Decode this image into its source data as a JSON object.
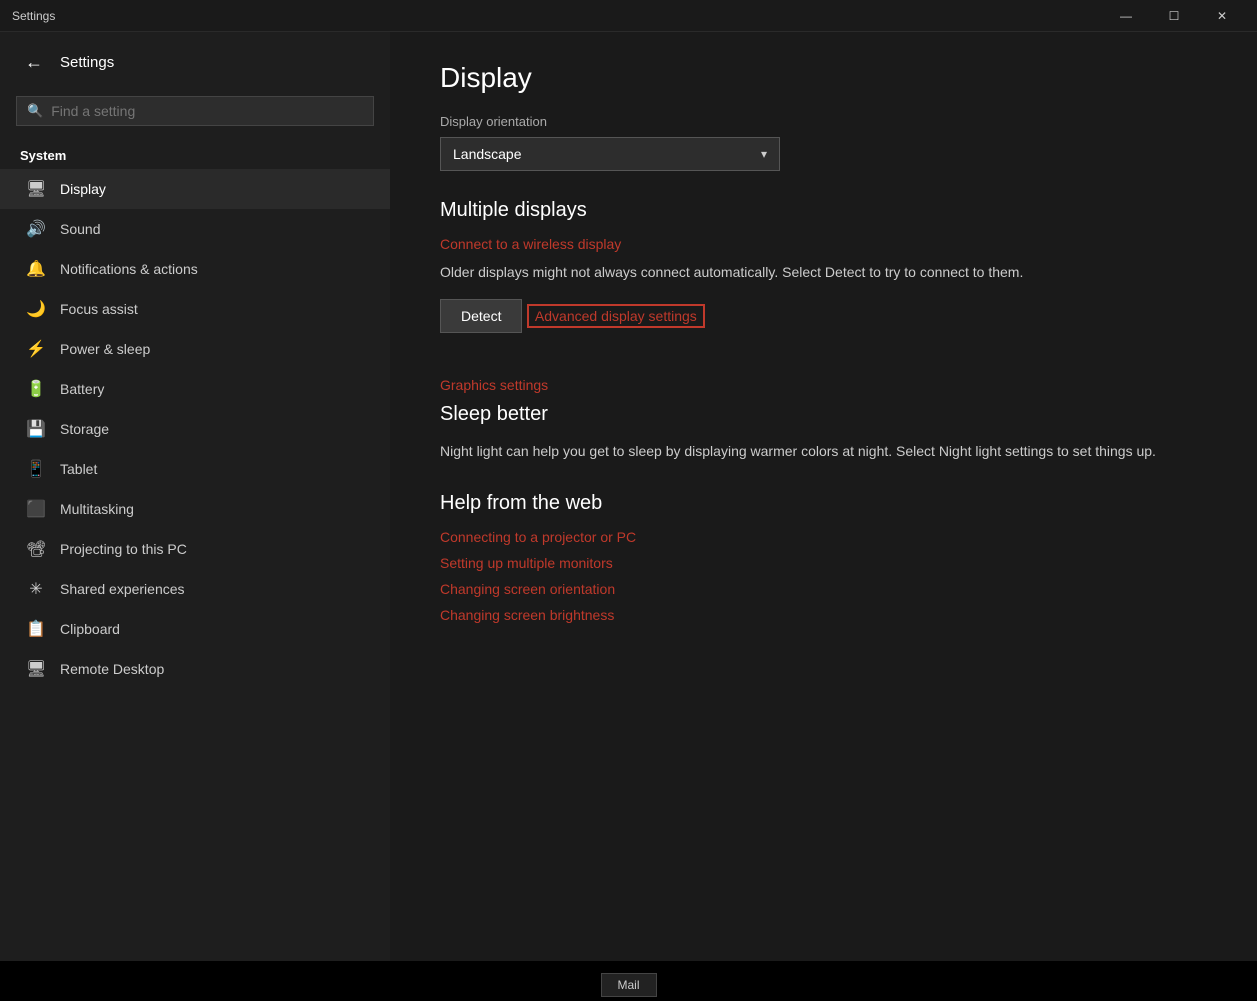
{
  "titlebar": {
    "title": "Settings",
    "minimize": "—",
    "restore": "☐",
    "close": "✕"
  },
  "sidebar": {
    "back_label": "←",
    "app_name": "Settings",
    "search_placeholder": "Find a setting",
    "system_label": "System",
    "nav_items": [
      {
        "id": "display",
        "icon": "🖥",
        "label": "Display",
        "active": true
      },
      {
        "id": "sound",
        "icon": "🔊",
        "label": "Sound",
        "active": false
      },
      {
        "id": "notifications",
        "icon": "🔔",
        "label": "Notifications & actions",
        "active": false
      },
      {
        "id": "focus",
        "icon": "🌙",
        "label": "Focus assist",
        "active": false
      },
      {
        "id": "power",
        "icon": "⚡",
        "label": "Power & sleep",
        "active": false
      },
      {
        "id": "battery",
        "icon": "🔋",
        "label": "Battery",
        "active": false
      },
      {
        "id": "storage",
        "icon": "💾",
        "label": "Storage",
        "active": false
      },
      {
        "id": "tablet",
        "icon": "📱",
        "label": "Tablet",
        "active": false
      },
      {
        "id": "multitasking",
        "icon": "⬛",
        "label": "Multitasking",
        "active": false
      },
      {
        "id": "projecting",
        "icon": "📽",
        "label": "Projecting to this PC",
        "active": false
      },
      {
        "id": "shared",
        "icon": "✳",
        "label": "Shared experiences",
        "active": false
      },
      {
        "id": "clipboard",
        "icon": "📋",
        "label": "Clipboard",
        "active": false
      },
      {
        "id": "remote",
        "icon": "🖥",
        "label": "Remote Desktop",
        "active": false
      }
    ]
  },
  "main": {
    "page_title": "Display",
    "orientation_label": "Display orientation",
    "orientation_value": "Landscape",
    "multiple_displays_heading": "Multiple displays",
    "wireless_display_link": "Connect to a wireless display",
    "older_displays_text": "Older displays might not always connect automatically. Select Detect to try to connect to them.",
    "detect_button": "Detect",
    "advanced_settings_link": "Advanced display settings",
    "graphics_settings_link": "Graphics settings",
    "sleep_better_heading": "Sleep better",
    "sleep_better_text": "Night light can help you get to sleep by displaying warmer colors at night. Select Night light settings to set things up.",
    "help_heading": "Help from the web",
    "help_links": [
      "Connecting to a projector or PC",
      "Setting up multiple monitors",
      "Changing screen orientation",
      "Changing screen brightness"
    ],
    "taskbar_mail": "Mail"
  }
}
